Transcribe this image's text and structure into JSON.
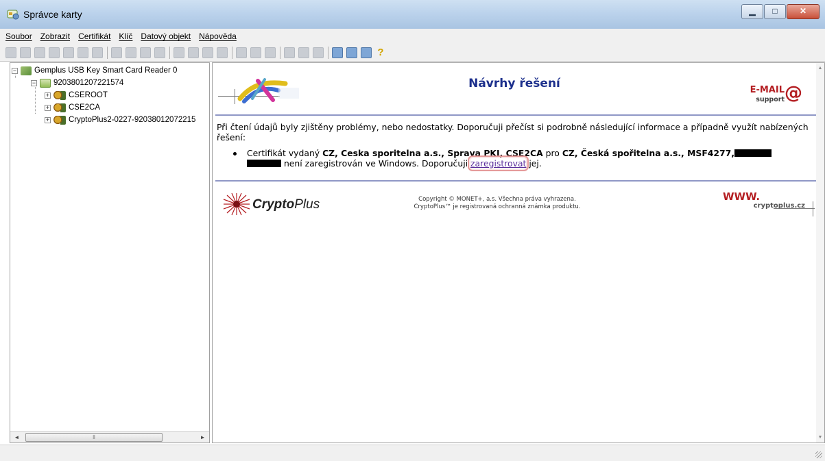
{
  "window": {
    "title": "Správce karty",
    "buttons": {
      "minimize": "▁",
      "maximize": "□",
      "close": "✕"
    }
  },
  "menu": [
    "Soubor",
    "Zobrazit",
    "Certifikát",
    "Klíč",
    "Datový objekt",
    "Nápověda"
  ],
  "toolbar": {
    "groups": [
      [
        "reader-icon",
        "card-icon",
        "key-icon",
        "key-icon",
        "person-icon",
        "person-icon",
        "person-icon"
      ],
      [
        "key-icon",
        "key-icon",
        "key-icon",
        "key-icon"
      ],
      [
        "cert-icon",
        "cert-icon",
        "cert-icon",
        "cert-icon"
      ],
      [
        "data-icon",
        "data-icon",
        "data-icon"
      ],
      [
        "data-icon",
        "data-icon",
        "data-icon"
      ],
      [
        "refresh-icon",
        "search-icon",
        "print-icon",
        "help-icon"
      ]
    ],
    "enabled_groups": [
      5
    ]
  },
  "tree": {
    "reader": "Gemplus USB Key Smart Card Reader 0",
    "card": "92038012072215​74",
    "certs": [
      "CSEROOT",
      "CSE2CA",
      "CryptoPlus2-0227-92038012072215"
    ]
  },
  "content": {
    "heading": "Návrhy řešení",
    "email_logo": {
      "main": "E-MAIL",
      "sub": "support",
      "at": "@"
    },
    "intro": "Při čtení údajů byly zjištěny problémy, nebo nedostatky. Doporučuji přečíst si podrobně následující informace a případně využít nabízených řešení:",
    "bullet": {
      "prefix": "Certifikát vydaný ",
      "issuer": "CZ, Ceska sporitelna a.s., Sprava PKI, CSE2CA",
      "mid": " pro ",
      "subject": "CZ, Česká spořitelna a.s., MSF4277,",
      "tail": "není zaregistrován ve Windows. Doporučuji ",
      "link": "zaregistrovat",
      "end": " jej."
    },
    "footer": {
      "brand_bold": "Crypto",
      "brand_italic": "Plus",
      "copyright_line1": "Copyright © MONET+, a.s. Všechna práva vyhrazena.",
      "copyright_line2": "CryptoPlus™ je registrovaná ochranná známka produktu.",
      "www": "WWW.",
      "site": "cryptoplus.cz"
    }
  },
  "colors": {
    "heading": "#1c2f8c",
    "rule": "#8f97c6",
    "brand_red": "#b41e22",
    "link": "#5a2d9c"
  }
}
